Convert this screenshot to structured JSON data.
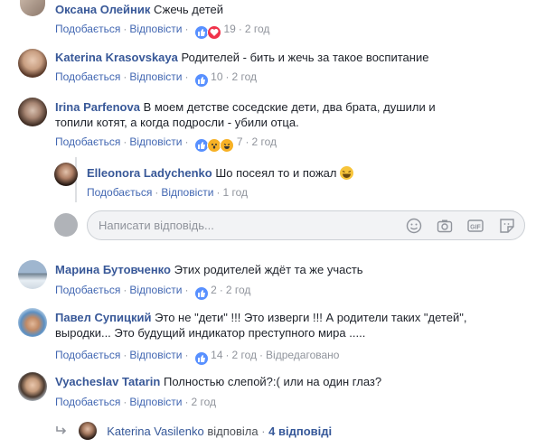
{
  "labels": {
    "like": "Подобається",
    "reply": "Відповісти",
    "dot": "·",
    "edited": "Відредаговано"
  },
  "comments": [
    {
      "author": "Оксана Олейник",
      "text": "Сжечь детей",
      "reactions": "19",
      "time": "2 год"
    },
    {
      "author": "Katerina Krasovskaya",
      "text": "Родителей - бить и жечь за такое воспитание",
      "reactions": "10",
      "time": "2 год"
    },
    {
      "author": "Irina Parfenova",
      "text_line1": "В моем детстве соседские дети, два брата, душили и",
      "text_line2": "топили котят, а когда подросли - убили отца.",
      "reactions": "7",
      "time": "2 год"
    },
    {
      "author": "Марина Бутовченко",
      "text": "Этих родителей ждёт та же участь",
      "reactions": "2",
      "time": "2 год"
    },
    {
      "author": "Павел Супицкий",
      "text_line1": "Это не \"дети\" !!! Это изверги !!! А родители таких \"детей\",",
      "text_line2": "выродки... Это будущий индикатор преступного мира .....",
      "reactions": "14",
      "time": "2 год"
    },
    {
      "author": "Vyacheslav Tatarin",
      "text": "Полностью слепой?:( или на один глаз?",
      "time": "2 год"
    }
  ],
  "reply": {
    "author": "Elleonora Ladychenko",
    "text": "Шо посеял то и пожал",
    "time": "1 год"
  },
  "reply_box": {
    "placeholder": "Написати відповідь..."
  },
  "replies_summary": {
    "who": "Katerina Vasilenko",
    "action": "відповіла",
    "count": "4 відповіді"
  },
  "colors": {
    "link": "#385898",
    "meta": "#90949c",
    "like": "#5890ff",
    "love": "#f0334b",
    "wow": "#f7b125"
  }
}
